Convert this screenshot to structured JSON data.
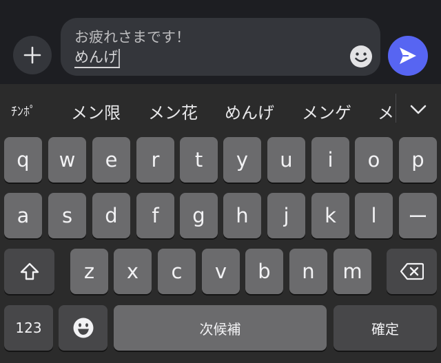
{
  "composer": {
    "message_line1": "お疲れさまです！",
    "message_line2": "めんげ"
  },
  "candidates": {
    "items": [
      "ﾁﾝﾎﾟ",
      "メン限",
      "メン花",
      "めんげ",
      "メンゲ"
    ],
    "partial": "メ"
  },
  "keyboard": {
    "row1": [
      "q",
      "w",
      "e",
      "r",
      "t",
      "y",
      "u",
      "i",
      "o",
      "p"
    ],
    "row2": [
      "a",
      "s",
      "d",
      "f",
      "g",
      "h",
      "j",
      "k",
      "l",
      "ー"
    ],
    "row3": [
      "z",
      "x",
      "c",
      "v",
      "b",
      "n",
      "m"
    ],
    "numbers_label": "123",
    "space_label": "次候補",
    "return_label": "確定"
  },
  "colors": {
    "send_button": "#5765f2",
    "key": "#6b6b6d",
    "function_key": "#474749",
    "background": "#2b2b2b"
  },
  "icons": {
    "attach": "plus-icon",
    "emoji": "smiley-icon",
    "send": "send-arrow-icon",
    "shift": "shift-arrow-icon",
    "delete": "backspace-icon",
    "expand": "chevron-down-icon",
    "emoji_keyboard": "emoji-face-icon"
  }
}
